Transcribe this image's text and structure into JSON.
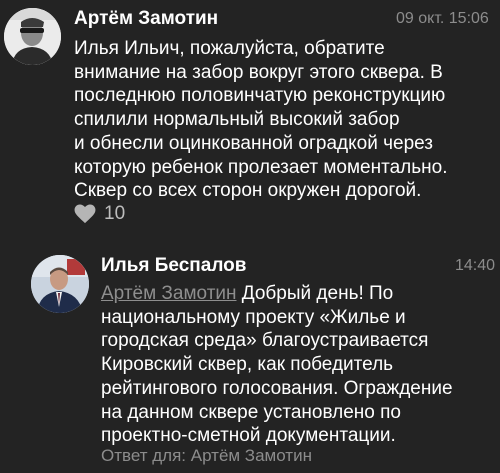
{
  "comment": {
    "author": "Артём Замотин",
    "time": "09 окт. 15:06",
    "lines": [
      "Илья Ильич, пожалуйста, обратите",
      "внимание на забор вокруг этого сквера. В",
      "последнюю половинчатую реконструкцию",
      "спилили нормальный высокий забор",
      "и   обнесли оцинкованной оградкой через",
      "которую ребенок пролезает моментально.",
      "Сквер со всех сторон окружен дорогой."
    ],
    "likes_count": "10",
    "like_icon": "heart-icon"
  },
  "reply": {
    "author": "Илья Беспалов",
    "time": "14:40",
    "mention": "Артём Замотин",
    "first_line_rest": " Добрый день! По",
    "lines": [
      "национальному проекту «Жилье и",
      "городская среда» благоустраивается",
      "Кировский сквер, как победитель",
      "рейтингового голосования. Ограждение",
      "на данном сквере установлено по",
      "проектно-сметной документации."
    ],
    "reply_to": "Ответ для: Артём Замотин"
  }
}
